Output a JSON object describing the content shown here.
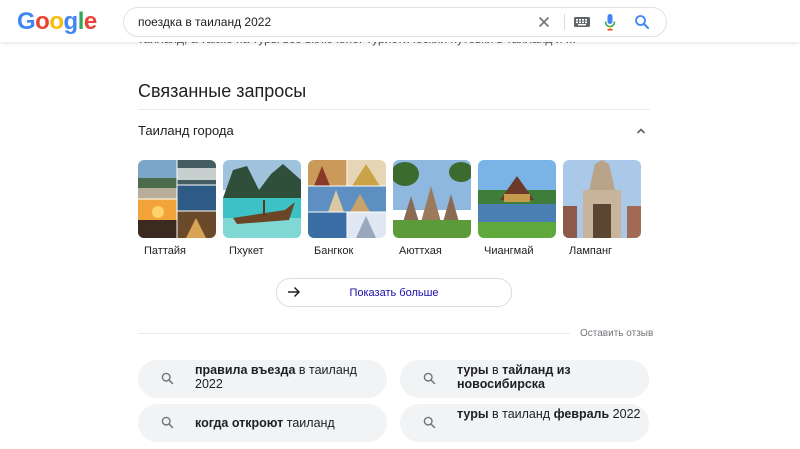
{
  "header": {
    "logo_letters": [
      {
        "ch": "G",
        "color": "#4285F4"
      },
      {
        "ch": "o",
        "color": "#EA4335"
      },
      {
        "ch": "o",
        "color": "#FBBC05"
      },
      {
        "ch": "g",
        "color": "#4285F4"
      },
      {
        "ch": "l",
        "color": "#34A853"
      },
      {
        "ch": "e",
        "color": "#EA4335"
      }
    ],
    "search_query": "поездка в таиланд 2022",
    "icons": {
      "clear": "close-icon",
      "keyboard": "keyboard-icon",
      "voice": "microphone-icon",
      "search": "search-icon"
    }
  },
  "cut_off_text": "таиланд, а также на туры все включено. Туристический путевки в таиланд и ...",
  "related": {
    "title": "Связанные запросы",
    "group_title": "Таиланд города",
    "cities": [
      "Паттайя",
      "Пхукет",
      "Бангкок",
      "Аюттхая",
      "Чиангмай",
      "Лампанг"
    ],
    "show_more": "Показать больше",
    "feedback": "Оставить отзыв"
  },
  "searches": [
    {
      "parts": [
        {
          "t": "правила въезда",
          "b": true
        },
        {
          "t": " в таиланд 2022",
          "b": false
        }
      ]
    },
    {
      "parts": [
        {
          "t": "туры",
          "b": true
        },
        {
          "t": " в ",
          "b": false
        },
        {
          "t": "тайланд из новосибирска",
          "b": true
        }
      ]
    },
    {
      "parts": [
        {
          "t": "когда откроют",
          "b": true
        },
        {
          "t": " таиланд",
          "b": false
        }
      ]
    },
    {
      "parts": [
        {
          "t": "туры",
          "b": true
        },
        {
          "t": " в таиланд ",
          "b": false
        },
        {
          "t": "февраль",
          "b": true
        },
        {
          "t": " 2022",
          "b": false
        }
      ]
    }
  ],
  "colors": {
    "accent_blue": "#1a73e8",
    "link": "#1a0dab",
    "chip_bg": "#f1f3f4"
  }
}
